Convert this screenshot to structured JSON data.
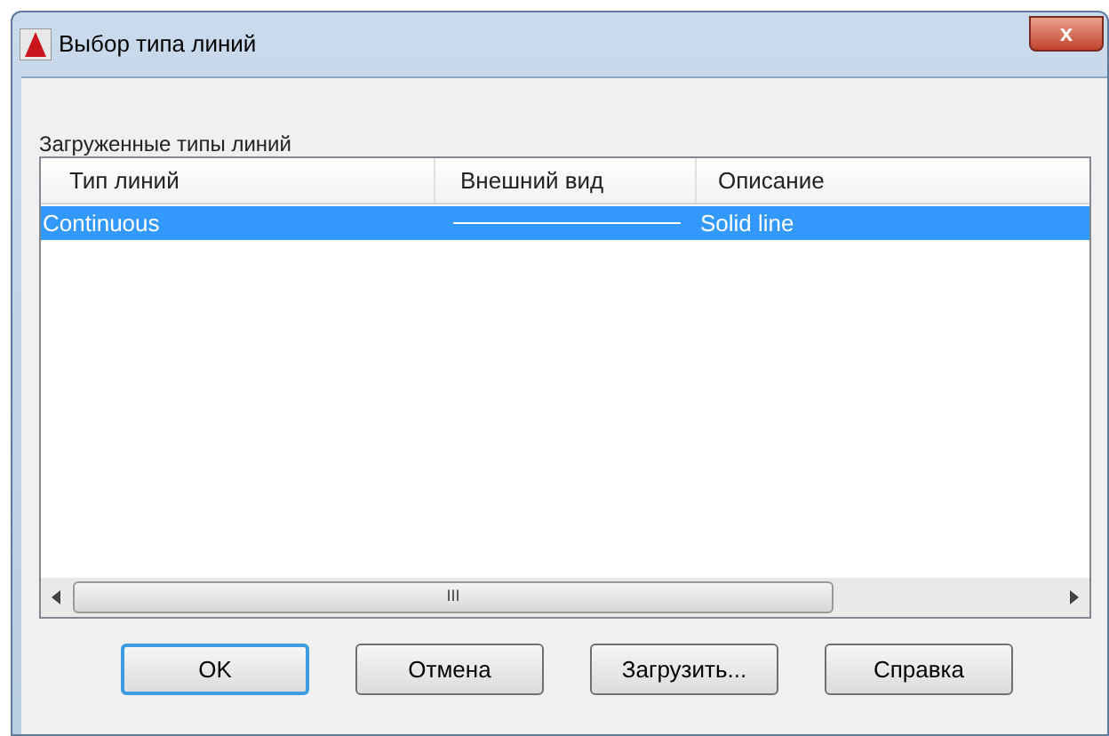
{
  "window": {
    "title": "Выбор типа линий"
  },
  "close_button": {
    "label": "x"
  },
  "list_label": "Загруженные типы линий",
  "table": {
    "columns": [
      "Тип линий",
      "Внешний вид",
      "Описание"
    ],
    "rows": [
      {
        "name": "Continuous",
        "description": "Solid line",
        "selected": true
      }
    ]
  },
  "scrollbar": {
    "grip": "III"
  },
  "buttons": [
    {
      "label": "OK",
      "default": true
    },
    {
      "label": "Отмена",
      "default": false
    },
    {
      "label": "Загрузить...",
      "default": false
    },
    {
      "label": "Справка",
      "default": false
    }
  ]
}
